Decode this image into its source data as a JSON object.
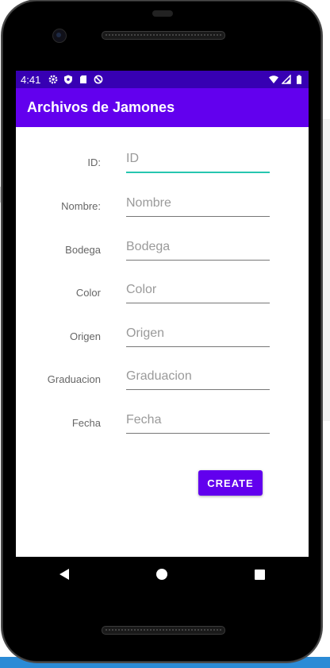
{
  "status_bar": {
    "time": "4:41",
    "left_icons": [
      "settings-icon",
      "shield-icon",
      "sd-card-icon",
      "do-not-disturb-icon"
    ],
    "right_icons": [
      "wifi-icon",
      "signal-icon",
      "battery-icon"
    ]
  },
  "app_bar": {
    "title": "Archivos de Jamones",
    "color": "#6200ee"
  },
  "status_bar_color": "#3700b3",
  "form": {
    "fields": [
      {
        "label": "ID:",
        "placeholder": "ID",
        "value": "",
        "focused": true
      },
      {
        "label": "Nombre:",
        "placeholder": "Nombre",
        "value": ""
      },
      {
        "label": "Bodega",
        "placeholder": "Bodega",
        "value": ""
      },
      {
        "label": "Color",
        "placeholder": "Color",
        "value": ""
      },
      {
        "label": "Origen",
        "placeholder": "Origen",
        "value": ""
      },
      {
        "label": "Graduacion",
        "placeholder": "Graduacion",
        "value": ""
      },
      {
        "label": "Fecha",
        "placeholder": "Fecha",
        "value": ""
      }
    ],
    "create_label": "CREATE"
  },
  "nav_bar": {
    "icons": [
      "back-icon",
      "home-icon",
      "recents-icon"
    ]
  }
}
